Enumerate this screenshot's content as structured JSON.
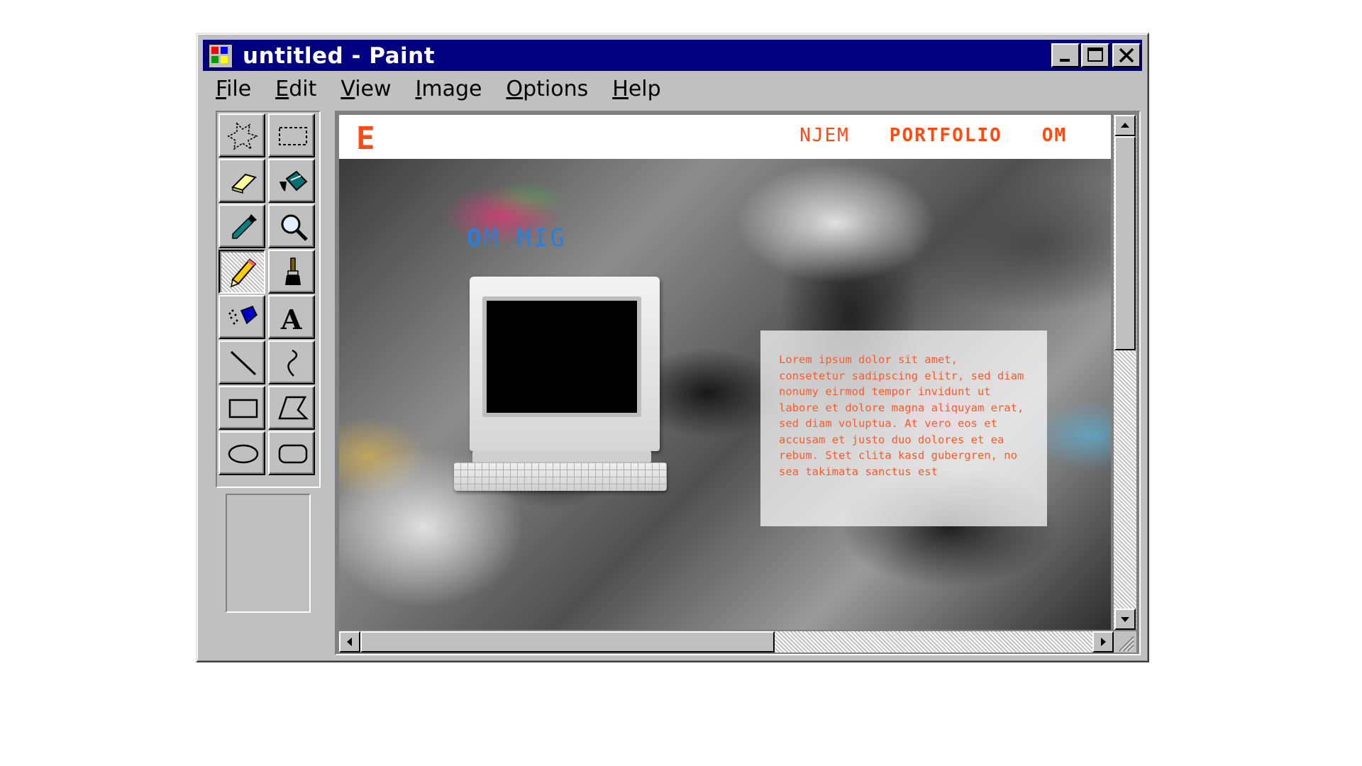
{
  "window": {
    "title": "untitled - Paint",
    "title_color": "#000080"
  },
  "menu": [
    {
      "hotkey": "F",
      "rest": "ile"
    },
    {
      "hotkey": "E",
      "rest": "dit"
    },
    {
      "hotkey": "V",
      "rest": "iew"
    },
    {
      "hotkey": "I",
      "rest": "mage"
    },
    {
      "hotkey": "O",
      "rest": "ptions"
    },
    {
      "hotkey": "H",
      "rest": "elp"
    }
  ],
  "tools": [
    "free-form-select-icon",
    "rectangle-select-icon",
    "eraser-icon",
    "fill-bucket-icon",
    "color-picker-icon",
    "magnifier-icon",
    "pencil-icon",
    "brush-icon",
    "airbrush-icon",
    "text-icon",
    "line-icon",
    "curve-icon",
    "rectangle-icon",
    "polygon-icon",
    "ellipse-icon",
    "rounded-rectangle-icon"
  ],
  "active_tool": "pencil-icon",
  "site": {
    "logo": "E",
    "nav": [
      "NJEM",
      "PORTFOLIO",
      "OM"
    ],
    "hero_title_first": "O",
    "hero_title_rest": "M MIG",
    "body": "Lorem ipsum dolor sit amet, consetetur sadipscing elitr, sed diam nonumy eirmod tempor invidunt ut labore et dolore magna aliquyam erat, sed diam voluptua. At vero eos et accusam et justo duo dolores et ea rebum. Stet clita kasd gubergren, no sea takimata sanctus est",
    "accent_color": "#ff4a12",
    "title_color": "#2a7fd6"
  },
  "scroll": {
    "vertical_position": 0.0,
    "horizontal_position": 0.0
  }
}
